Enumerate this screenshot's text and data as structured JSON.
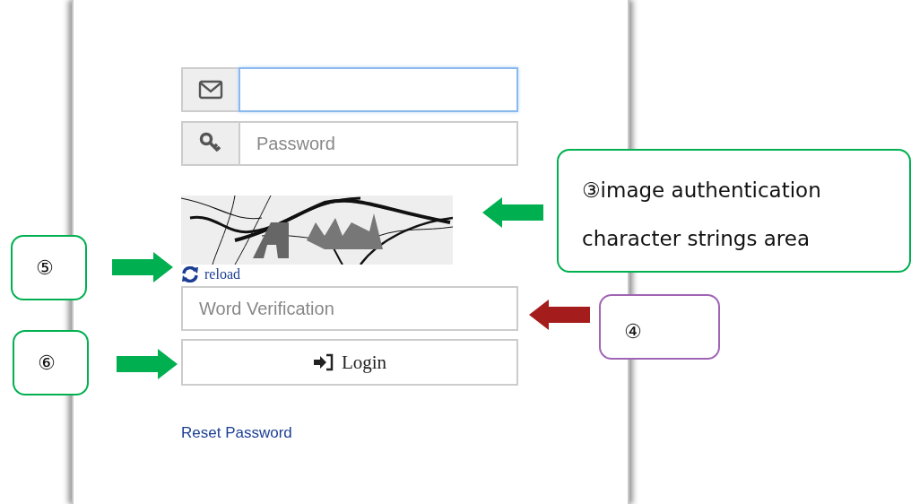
{
  "login_form": {
    "email": {
      "focused": true
    },
    "password": {
      "placeholder": "Password"
    },
    "reload": {
      "label": "reload"
    },
    "word_verification": {
      "placeholder": "Word Verification"
    },
    "login_button": {
      "label": "Login"
    },
    "reset_link": {
      "label": "Reset Password"
    }
  },
  "callouts": [
    {
      "text": "③image authentication character strings area",
      "color": "#00b050"
    },
    {
      "text": "⑤",
      "color": "#00b050"
    },
    {
      "text": "⑥",
      "color": "#00b050"
    },
    {
      "text": "④",
      "color": "#a064b4"
    }
  ],
  "arrows": [
    {
      "kind": "leftward",
      "color": "#00b050"
    },
    {
      "kind": "rightward",
      "color": "#00b050"
    },
    {
      "kind": "rightward",
      "color": "#00b050"
    },
    {
      "kind": "leftward",
      "color": "#a51c1c"
    }
  ]
}
